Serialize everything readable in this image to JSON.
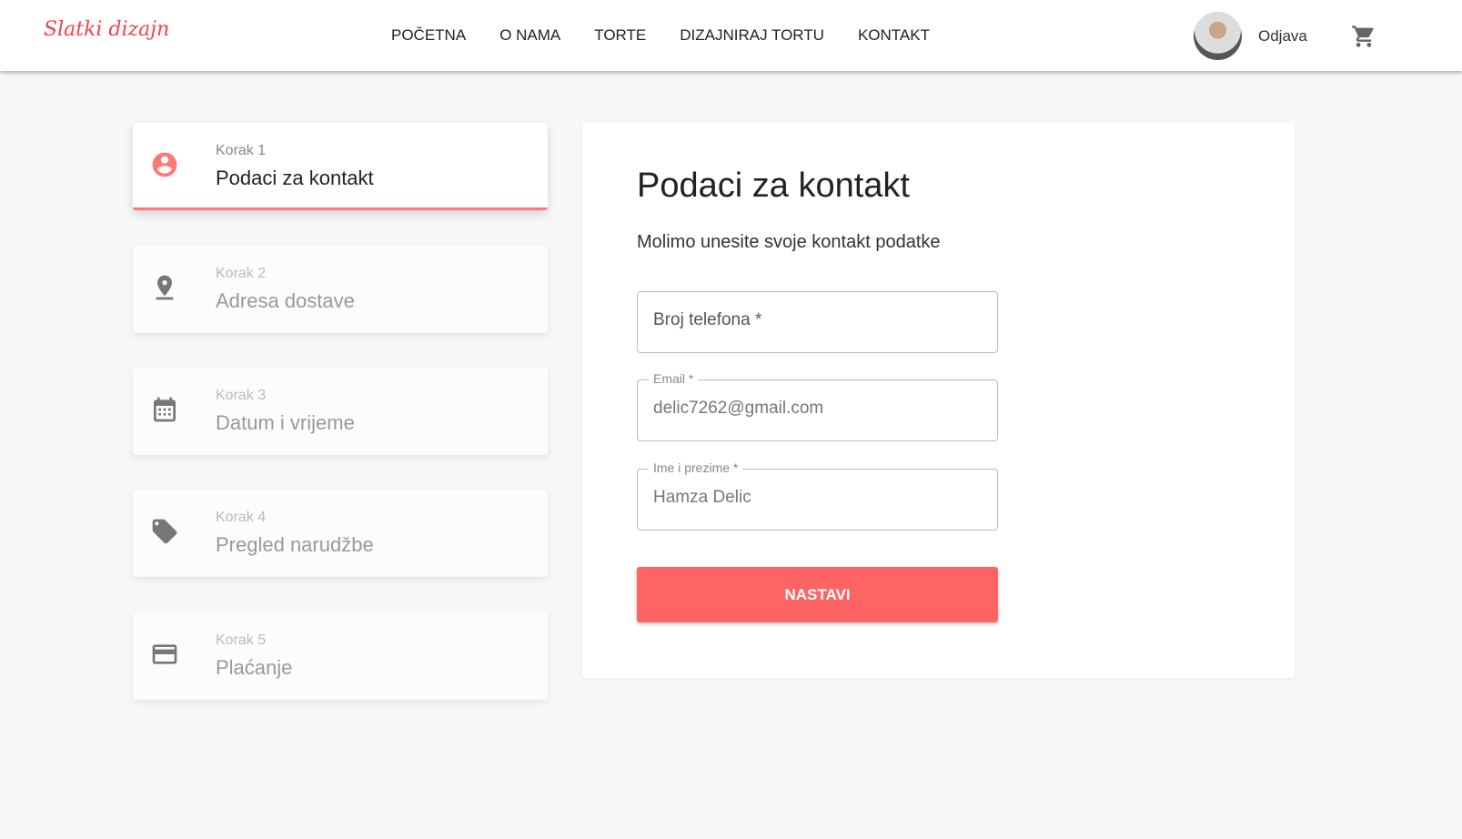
{
  "nav": {
    "logo": "Slatki dizajn",
    "links": [
      "POČETNA",
      "O NAMA",
      "TORTE",
      "DIZAJNIRAJ TORTU",
      "KONTAKT"
    ],
    "logout": "Odjava"
  },
  "steps": [
    {
      "step": "Korak 1",
      "title": "Podaci za kontakt",
      "icon": "account-circle-icon"
    },
    {
      "step": "Korak 2",
      "title": "Adresa dostave",
      "icon": "location-pin-icon"
    },
    {
      "step": "Korak 3",
      "title": "Datum i vrijeme",
      "icon": "calendar-icon"
    },
    {
      "step": "Korak 4",
      "title": "Pregled narudžbe",
      "icon": "tag-icon"
    },
    {
      "step": "Korak 5",
      "title": "Plaćanje",
      "icon": "credit-card-icon"
    }
  ],
  "form": {
    "title": "Podaci za kontakt",
    "subtitle": "Molimo unesite svoje kontakt podatke",
    "phone_placeholder": "Broj telefona *",
    "email_label": "Email *",
    "email_value": "delic7262@gmail.com",
    "name_label": "Ime i prezime *",
    "name_value": "Hamza Delic",
    "submit": "NASTAVI"
  },
  "colors": {
    "accent": "#ff6464",
    "logo": "#f2424a"
  }
}
